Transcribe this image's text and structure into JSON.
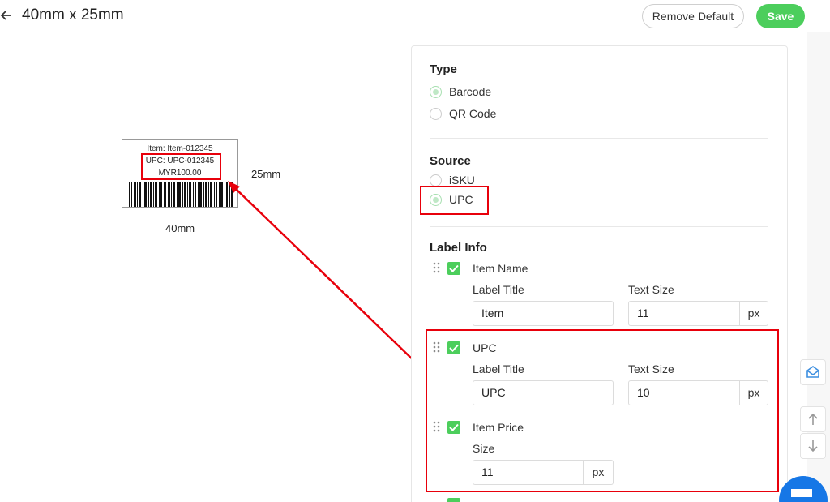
{
  "header": {
    "title": "40mm x 25mm",
    "remove_default_label": "Remove Default",
    "save_label": "Save"
  },
  "preview": {
    "item_line": "Item: Item-012345",
    "upc_line": "UPC: UPC-012345",
    "price_line": "MYR100.00",
    "height_label": "25mm",
    "width_label": "40mm"
  },
  "type_section": {
    "title": "Type",
    "options": [
      "Barcode",
      "QR Code"
    ],
    "selected": "Barcode"
  },
  "source_section": {
    "title": "Source",
    "options": [
      "iSKU",
      "UPC"
    ],
    "selected": "UPC"
  },
  "label_info": {
    "title": "Label Info",
    "items": [
      {
        "name": "Item Name",
        "checked": true,
        "label_title_caption": "Label Title",
        "label_title_value": "Item",
        "text_size_caption": "Text Size",
        "text_size_value": "11",
        "unit": "px"
      },
      {
        "name": "UPC",
        "checked": true,
        "label_title_caption": "Label Title",
        "label_title_value": "UPC",
        "text_size_caption": "Text Size",
        "text_size_value": "10",
        "unit": "px"
      },
      {
        "name": "Item Price",
        "checked": true,
        "size_caption": "Size",
        "size_value": "11",
        "unit": "px"
      }
    ]
  },
  "colors": {
    "accent": "#4cce5c",
    "highlight": "#e8000b",
    "chat": "#1677e6"
  },
  "icons": [
    "back-arrow-icon",
    "drag-handle-icon",
    "checkbox-checked-icon",
    "mail-icon",
    "arrow-up-icon",
    "arrow-down-icon",
    "chat-icon"
  ]
}
